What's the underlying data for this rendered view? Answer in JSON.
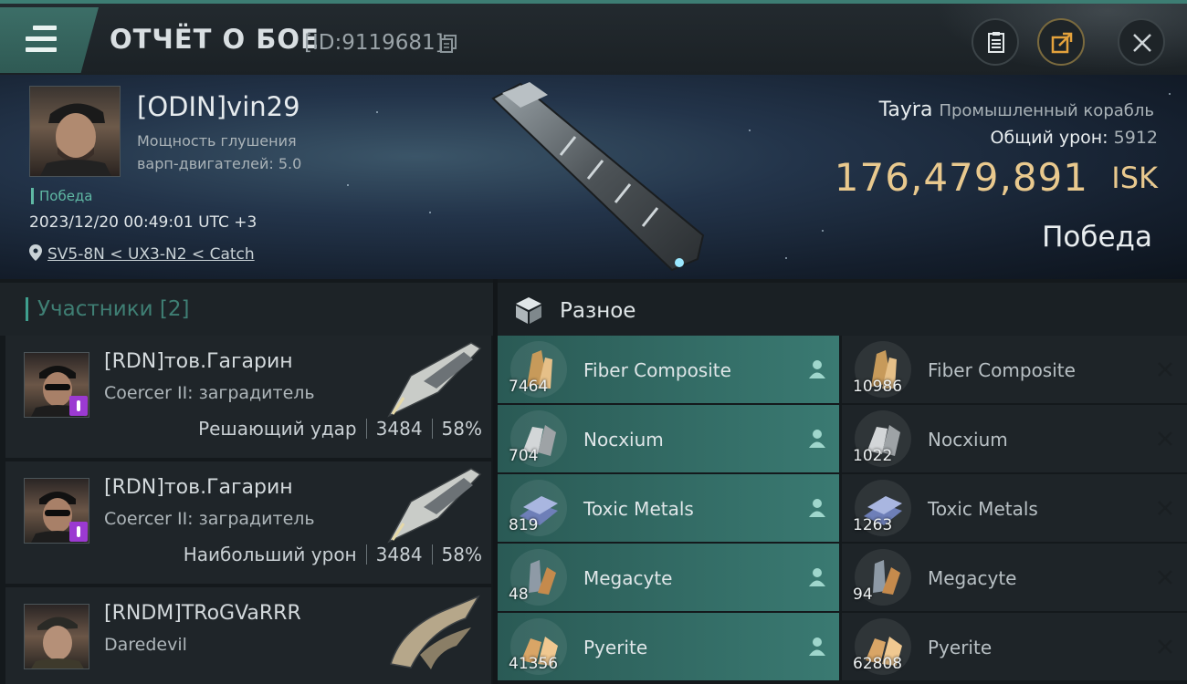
{
  "header": {
    "title": "ОТЧЁТ О БОЕ",
    "battle_id": "[ID:9119681]"
  },
  "victim": {
    "name": "[ODIN]vin29",
    "attribute_line1": "Мощность глушения",
    "attribute_line2": "варп-двигателей: 5.0",
    "result_tag": "Победа",
    "datetime": "2023/12/20 00:49:01 UTC +3",
    "location": "SV5-8N < UX3-N2 < Catch",
    "ship_name": "Tayra",
    "ship_class": "Промышленный корабль",
    "total_damage_label": "Общий урон:",
    "total_damage_value": "5912",
    "isk_value": "176,479,891",
    "isk_unit": "ISK",
    "result": "Победа"
  },
  "participants": {
    "title": "Участники [2]",
    "rows": [
      {
        "name": "[RDN]тов.Гагарин",
        "ship": "Coercer II: заградитель",
        "role": "Решающий удар",
        "damage": "3484",
        "percent": "58%"
      },
      {
        "name": "[RDN]тов.Гагарин",
        "ship": "Coercer II: заградитель",
        "role": "Наибольший урон",
        "damage": "3484",
        "percent": "58%"
      },
      {
        "name": "[RNDM]TRoGVaRRR",
        "ship": "Daredevil"
      }
    ]
  },
  "misc": {
    "title": "Разное",
    "dropped": [
      {
        "name": "Fiber Composite",
        "qty": "7464",
        "icon": "fiber-composite-icon"
      },
      {
        "name": "Nocxium",
        "qty": "704",
        "icon": "nocxium-icon"
      },
      {
        "name": "Toxic Metals",
        "qty": "819",
        "icon": "toxic-metals-icon"
      },
      {
        "name": "Megacyte",
        "qty": "48",
        "icon": "megacyte-icon"
      },
      {
        "name": "Pyerite",
        "qty": "41356",
        "icon": "pyerite-icon"
      }
    ],
    "destroyed": [
      {
        "name": "Fiber Composite",
        "qty": "10986",
        "icon": "fiber-composite-icon"
      },
      {
        "name": "Nocxium",
        "qty": "1022",
        "icon": "nocxium-icon"
      },
      {
        "name": "Toxic Metals",
        "qty": "1263",
        "icon": "toxic-metals-icon"
      },
      {
        "name": "Megacyte",
        "qty": "94",
        "icon": "megacyte-icon"
      },
      {
        "name": "Pyerite",
        "qty": "62808",
        "icon": "pyerite-icon"
      }
    ]
  },
  "colors": {
    "accent_teal": "#3f9f8e",
    "isk_gold": "#e9c98e",
    "dropped_bg": "#3a7a72"
  }
}
